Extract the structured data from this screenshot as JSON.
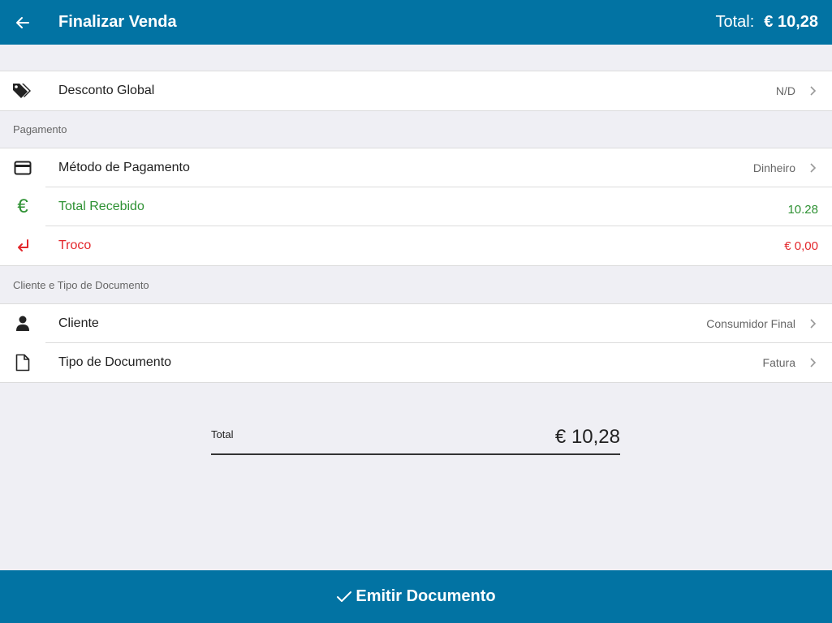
{
  "header": {
    "title": "Finalizar Venda",
    "total_label": "Total:",
    "total_value": "€ 10,28"
  },
  "discount": {
    "label": "Desconto Global",
    "value": "N/D"
  },
  "payment_section": {
    "title": "Pagamento",
    "method": {
      "label": "Método de Pagamento",
      "value": "Dinheiro"
    },
    "received": {
      "label": "Total Recebido",
      "value": "10.28"
    },
    "change": {
      "label": "Troco",
      "value": "€ 0,00"
    }
  },
  "client_section": {
    "title": "Cliente e Tipo de Documento",
    "client": {
      "label": "Cliente",
      "value": "Consumidor Final"
    },
    "doc_type": {
      "label": "Tipo de Documento",
      "value": "Fatura"
    }
  },
  "summary": {
    "label": "Total",
    "value": "€ 10,28"
  },
  "emit_button": {
    "label": "Emitir Documento"
  },
  "colors": {
    "primary": "#0273a3",
    "received": "#2e9133",
    "change": "#e3262b"
  },
  "icons": [
    "back-arrow-icon",
    "tags-icon",
    "credit-card-icon",
    "euro-icon",
    "return-arrow-icon",
    "user-icon",
    "document-icon",
    "chevron-right-icon",
    "checkmark-icon"
  ]
}
